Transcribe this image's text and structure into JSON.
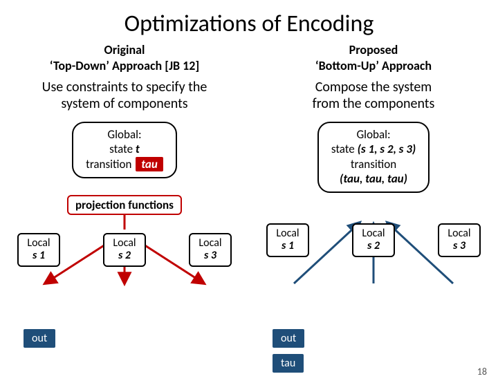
{
  "title": "Optimizations of Encoding",
  "left": {
    "subtitle_l1": "Original",
    "subtitle_l2": "‘Top-Down’ Approach [JB 12]",
    "desc_l1": "Use constraints to specify the",
    "desc_l2": "system of components",
    "global_l1": "Global:",
    "global_l2a": "state ",
    "global_l2b": "t",
    "global_l3a": "transition ",
    "global_l3b": "tau",
    "proj_label": "projection functions",
    "locals": [
      {
        "name": "Local",
        "state": "s 1"
      },
      {
        "name": "Local",
        "state": "s 2"
      },
      {
        "name": "Local",
        "state": "s 3"
      }
    ],
    "out": "out"
  },
  "right": {
    "subtitle_l1": "Proposed",
    "subtitle_l2": "‘Bottom-Up’ Approach",
    "desc_l1": "Compose the system",
    "desc_l2": "from the components",
    "global_l1": "Global:",
    "global_l2a": "state ",
    "global_l2b": "(s 1, s 2, s 3)",
    "global_l3a": "transition",
    "global_l3b": "(tau, tau, tau)",
    "locals": [
      {
        "name": "Local",
        "state": "s 1"
      },
      {
        "name": "Local",
        "state": "s 2"
      },
      {
        "name": "Local",
        "state": "s 3"
      }
    ],
    "out": "out",
    "tau": "tau"
  },
  "slidenum": "18",
  "colors": {
    "red": "#c00000",
    "navy": "#1f4e79"
  }
}
